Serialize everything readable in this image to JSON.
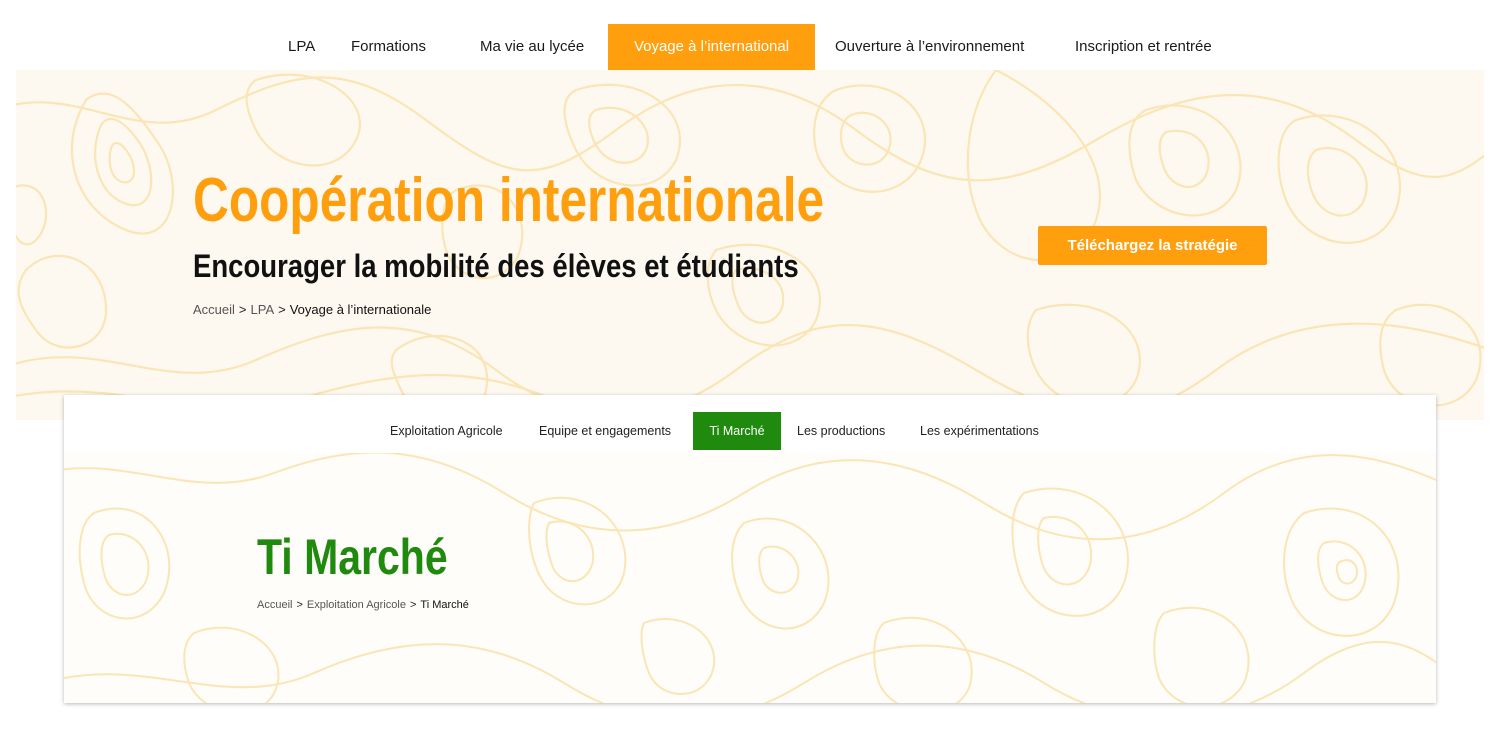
{
  "top_nav": {
    "items": [
      {
        "label": "LPA"
      },
      {
        "label": "Formations"
      },
      {
        "label": "Ma vie au lycée"
      },
      {
        "label": "Voyage à l’international"
      },
      {
        "label": "Ouverture à l’environnement"
      },
      {
        "label": "Inscription et rentrée"
      }
    ],
    "active_index": 3
  },
  "hero": {
    "title": "Coopération internationale",
    "subtitle": "Encourager la mobilité des élèves et étudiants",
    "breadcrumb": {
      "items": [
        "Accueil",
        "LPA"
      ],
      "separator": ">",
      "current": "Voyage à l’internationale"
    },
    "cta_label": "Téléchargez la stratégie"
  },
  "section": {
    "tabs": [
      {
        "label": "Exploitation Agricole"
      },
      {
        "label": "Equipe et engagements"
      },
      {
        "label": "Ti Marché"
      },
      {
        "label": "Les productions"
      },
      {
        "label": "Les expérimentations"
      }
    ],
    "active_tab": 2,
    "title": "Ti Marché",
    "breadcrumb": {
      "items": [
        "Accueil",
        "Exploitation Agricole"
      ],
      "separator": ">",
      "current": "Ti Marché"
    }
  },
  "colors": {
    "accent_orange": "#ff9f0e",
    "accent_green": "#1f8a0e",
    "pattern": "#fbe5b5"
  }
}
